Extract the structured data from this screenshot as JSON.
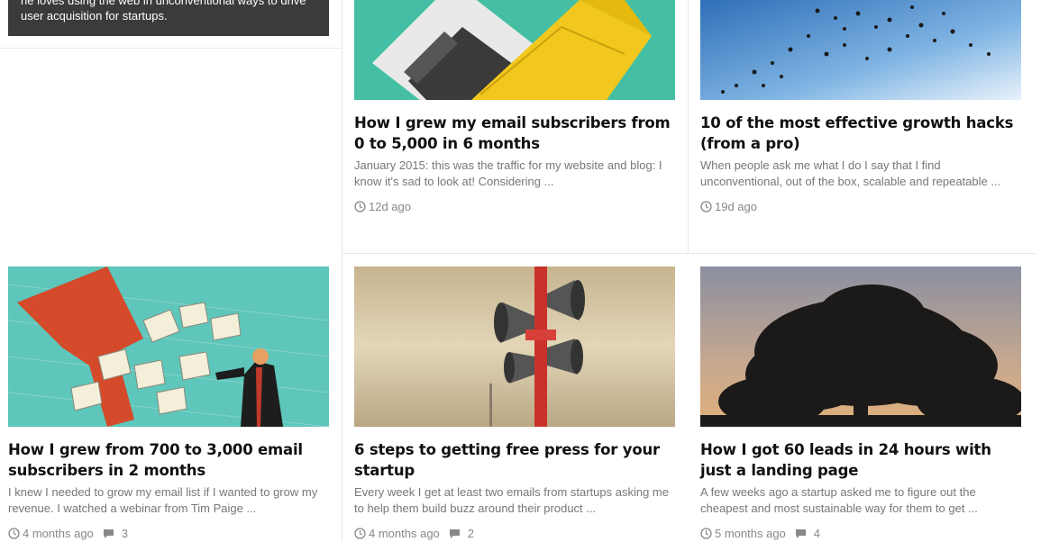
{
  "author_bio": {
    "text": "he loves using the web in unconventional ways to drive user acquisition for startups."
  },
  "posts": [
    {
      "title": "How I grew my email subscribers from 0 to 5,000 in 6 months",
      "excerpt": "January 2015: this was the traffic for my website and blog: I know it's sad to look at! Considering ...",
      "time": "12d ago",
      "comments": ""
    },
    {
      "title": "10 of the most effective growth hacks (from a pro)",
      "excerpt": "When people ask me what I do I say that I find unconventional, out of the box, scalable and repeatable ...",
      "time": "19d ago",
      "comments": ""
    },
    {
      "title": "How I grew from 700 to 3,000 email subscribers in 2 months",
      "excerpt": "I knew I needed to grow my email list if I wanted to grow my revenue. I watched a webinar from Tim Paige ...",
      "time": "4 months ago",
      "comments": "3"
    },
    {
      "title": "6 steps to getting free press for your startup",
      "excerpt": "Every week I get at least two emails from startups asking me to help them build buzz around their product ...",
      "time": "4 months ago",
      "comments": "2"
    },
    {
      "title": "How I got 60 leads in 24 hours with just a landing page",
      "excerpt": "A few weeks ago a startup asked me to figure out the cheapest and most sustainable way for them to get ...",
      "time": "5 months ago",
      "comments": "4"
    }
  ],
  "colors": {
    "bio_bg": "#3b3b3b",
    "teal": "#44bfa3",
    "envelope_yellow": "#f2c81e",
    "sky_blue": "#4a90d4",
    "envelope_red": "#d44a2b"
  }
}
